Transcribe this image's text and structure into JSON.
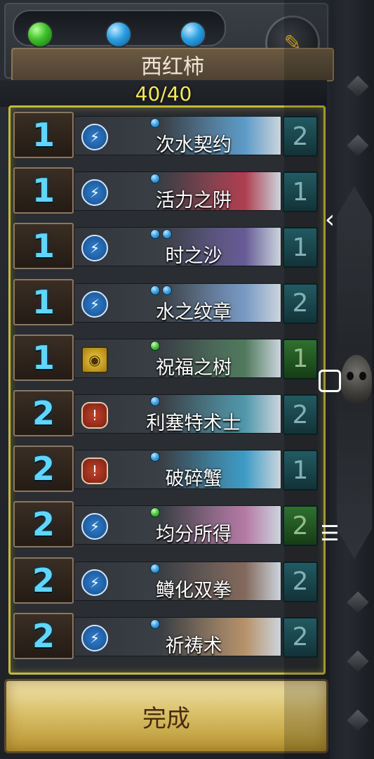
{
  "header": {
    "deck_name": "西红柿",
    "mana_gems": [
      "green",
      "blue",
      "blue"
    ],
    "edit_icon": "pencil-icon"
  },
  "deck_count": "40/40",
  "cards": [
    {
      "cost": "1",
      "name": "次水契约",
      "type": "spell",
      "dots": [
        "b"
      ],
      "qty": "2",
      "qty_color": "teal",
      "art": "#5fa6d8"
    },
    {
      "cost": "1",
      "name": "活力之阱",
      "type": "spell",
      "dots": [
        "b"
      ],
      "qty": "1",
      "qty_color": "teal",
      "art": "#c0394c"
    },
    {
      "cost": "1",
      "name": "时之沙",
      "type": "spell",
      "dots": [
        "b",
        "b"
      ],
      "qty": "1",
      "qty_color": "teal",
      "art": "#6b5ba0"
    },
    {
      "cost": "1",
      "name": "水之纹章",
      "type": "spell",
      "dots": [
        "b",
        "b"
      ],
      "qty": "2",
      "qty_color": "teal",
      "art": "#7fa5d6"
    },
    {
      "cost": "1",
      "name": "祝福之树",
      "type": "secret",
      "dots": [
        "g"
      ],
      "qty": "1",
      "qty_color": "green",
      "art": "#4f7f5c"
    },
    {
      "cost": "2",
      "name": "利塞特术士",
      "type": "minion",
      "dots": [
        "b"
      ],
      "qty": "2",
      "qty_color": "teal",
      "art": "#4fa3b8"
    },
    {
      "cost": "2",
      "name": "破碎蟹",
      "type": "minion",
      "dots": [
        "b"
      ],
      "qty": "1",
      "qty_color": "teal",
      "art": "#3aa8d8"
    },
    {
      "cost": "2",
      "name": "均分所得",
      "type": "spell",
      "dots": [
        "g"
      ],
      "qty": "2",
      "qty_color": "green",
      "art": "#c77fb0"
    },
    {
      "cost": "2",
      "name": "鳟化双拳",
      "type": "spell",
      "dots": [
        "b"
      ],
      "qty": "2",
      "qty_color": "teal",
      "art": "#8c6b5a"
    },
    {
      "cost": "2",
      "name": "祈祷术",
      "type": "spell",
      "dots": [
        "b"
      ],
      "qty": "2",
      "qty_color": "teal",
      "art": "#c99b6b"
    }
  ],
  "done_label": "完成",
  "system_nav": {
    "back_icon": "chevron-left-icon",
    "home_icon": "square-icon",
    "menu_icon": "menu-icon"
  }
}
